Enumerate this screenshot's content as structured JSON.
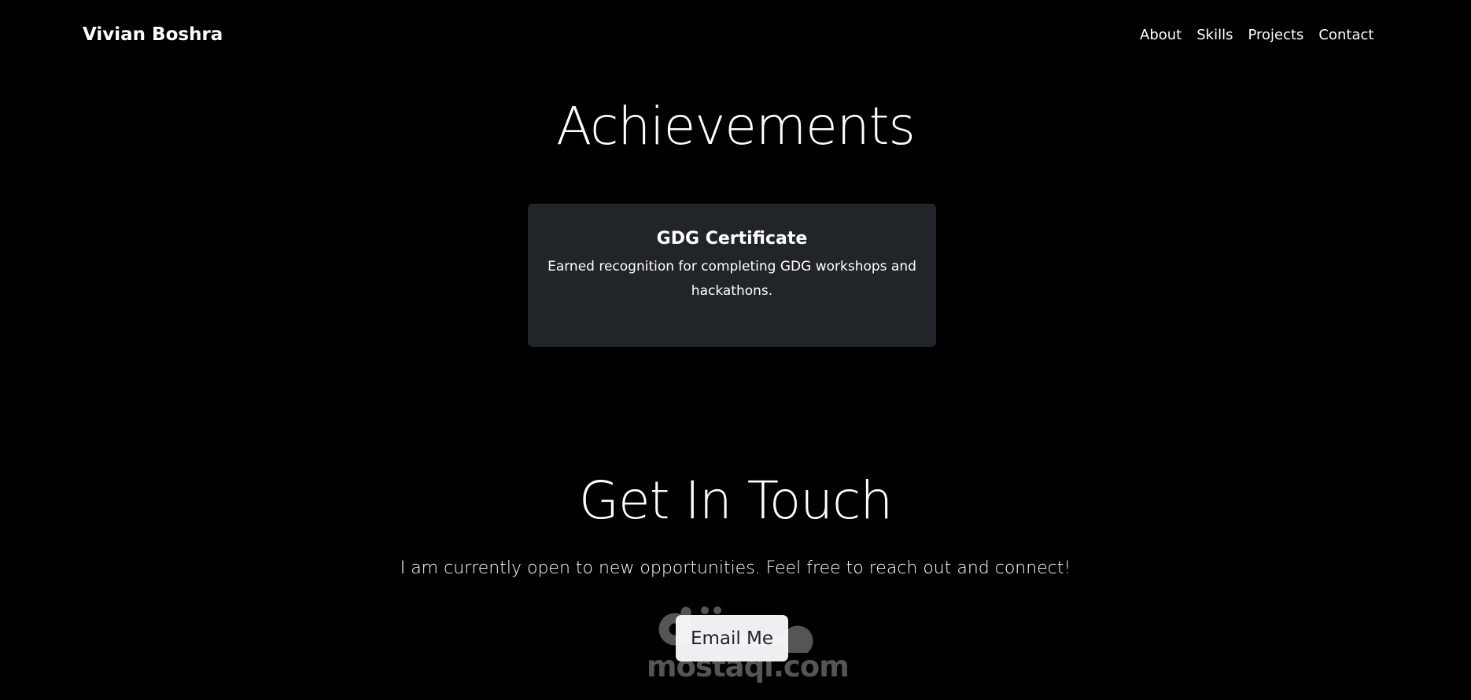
{
  "header": {
    "brand": "Vivian Boshra",
    "nav": [
      "About",
      "Skills",
      "Projects",
      "Contact"
    ]
  },
  "achievements": {
    "title": "Achievements",
    "cards": [
      {
        "title": "GDG Certificate",
        "text": "Earned recognition for completing GDG workshops and hackathons."
      }
    ]
  },
  "contact": {
    "title": "Get In Touch",
    "text": "I am currently open to new opportunities. Feel free to reach out and connect!",
    "button": "Email Me"
  },
  "watermark": {
    "logo_text": "مستقل",
    "text": "mostaql.com"
  }
}
